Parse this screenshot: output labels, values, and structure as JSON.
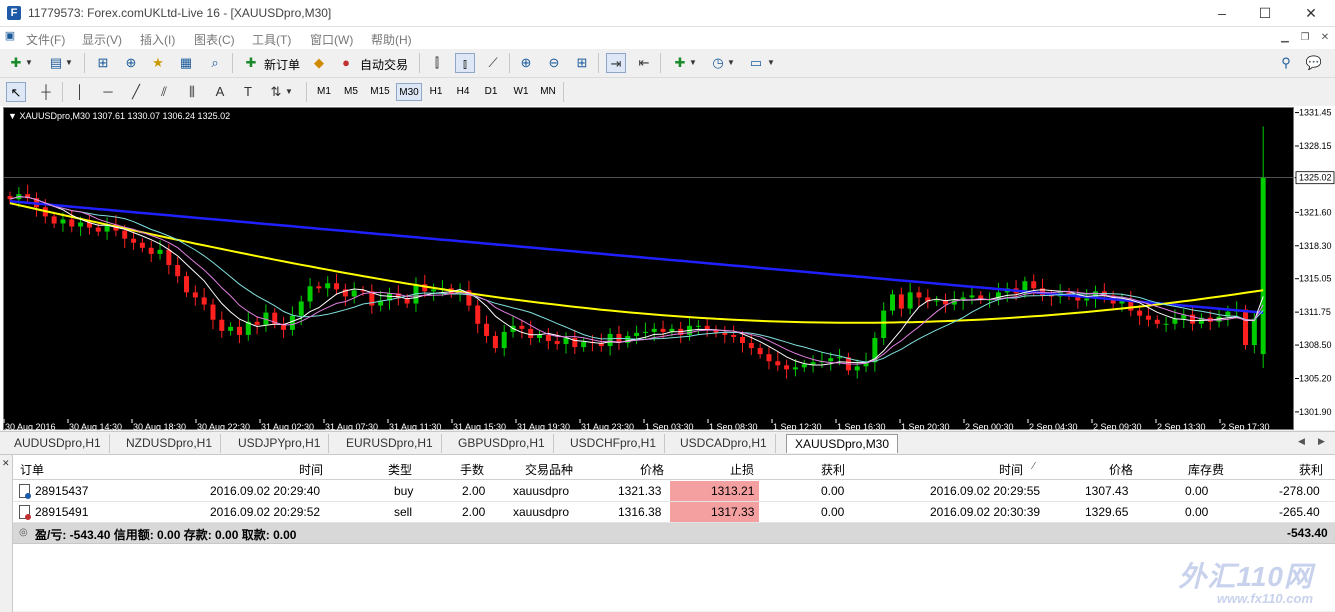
{
  "window": {
    "title": "11779573: Forex.comUKLtd-Live 16 - [XAUUSDpro,M30]",
    "app_icon": "F",
    "controls": [
      "–",
      "☐",
      "✕"
    ]
  },
  "menu": {
    "items": [
      "文件(F)",
      "显示(V)",
      "插入(I)",
      "图表(C)",
      "工具(T)",
      "窗口(W)",
      "帮助(H)"
    ]
  },
  "toolbar": {
    "new_order_label": "新订单",
    "auto_trade_label": "自动交易"
  },
  "timeframes": [
    "M1",
    "M5",
    "M15",
    "M30",
    "H1",
    "H4",
    "D1",
    "W1",
    "MN"
  ],
  "active_timeframe": "M30",
  "chart": {
    "header": "XAUUSDpro,M30  1307.61 1330.07 1306.24 1325.02",
    "current_price_label": "1325.02"
  },
  "chart_data": {
    "type": "candlestick",
    "symbol": "XAUUSDpro",
    "timeframe": "M30",
    "ohlc_last": {
      "open": 1307.61,
      "high": 1330.07,
      "low": 1306.24,
      "close": 1325.02
    },
    "price_ticks": [
      1331.45,
      1328.15,
      1325.02,
      1321.6,
      1318.3,
      1315.05,
      1311.75,
      1308.5,
      1305.2,
      1301.9
    ],
    "ylim": [
      1301.3,
      1331.9
    ],
    "time_ticks": [
      "30 Aug 2016",
      "30 Aug 14:30",
      "30 Aug 18:30",
      "30 Aug 22:30",
      "31 Aug 02:30",
      "31 Aug 07:30",
      "31 Aug 11:30",
      "31 Aug 15:30",
      "31 Aug 19:30",
      "31 Aug 23:30",
      "1 Sep 03:30",
      "1 Sep 08:30",
      "1 Sep 12:30",
      "1 Sep 16:30",
      "1 Sep 20:30",
      "2 Sep 00:30",
      "2 Sep 04:30",
      "2 Sep 09:30",
      "2 Sep 13:30",
      "2 Sep 17:30"
    ],
    "colors": {
      "background": "#000000",
      "bull": "#00cc00",
      "bear": "#ff2020",
      "ma_slow": "#2020ff",
      "ma_mid": "#ffff00",
      "ma_fast1": "#ffffff",
      "ma_fast2": "#80e0e0",
      "ma_fast3": "#e080e0"
    },
    "close_path": [
      1322.9,
      1323.4,
      1323.0,
      1322.1,
      1321.2,
      1320.5,
      1320.9,
      1320.2,
      1320.6,
      1320.1,
      1319.7,
      1320.4,
      1319.8,
      1319.0,
      1318.6,
      1318.1,
      1317.5,
      1317.9,
      1316.4,
      1315.3,
      1313.7,
      1313.2,
      1312.5,
      1311.0,
      1309.9,
      1310.3,
      1309.5,
      1310.8,
      1310.5,
      1311.7,
      1310.6,
      1310.0,
      1311.4,
      1312.8,
      1314.3,
      1314.1,
      1314.6,
      1314.0,
      1313.3,
      1313.9,
      1313.8,
      1312.4,
      1312.9,
      1313.6,
      1313.1,
      1312.6,
      1314.5,
      1313.8,
      1314.0,
      1314.1,
      1313.6,
      1313.9,
      1312.4,
      1310.6,
      1309.4,
      1308.2,
      1309.8,
      1310.4,
      1310.1,
      1309.2,
      1309.5,
      1308.9,
      1308.6,
      1309.2,
      1308.3,
      1308.8,
      1308.7,
      1308.4,
      1309.6,
      1308.7,
      1309.4,
      1309.7,
      1309.8,
      1310.1,
      1309.8,
      1310.1,
      1309.5,
      1310.4,
      1310.4,
      1310.0,
      1309.7,
      1309.5,
      1309.3,
      1308.7,
      1308.2,
      1307.6,
      1306.9,
      1306.5,
      1306.1,
      1306.3,
      1306.6,
      1306.8,
      1306.9,
      1307.2,
      1307.3,
      1306.0,
      1306.4,
      1306.8,
      1309.2,
      1311.9,
      1313.5,
      1312.1,
      1313.7,
      1313.2,
      1312.8,
      1312.9,
      1312.5,
      1312.9,
      1313.2,
      1313.4,
      1313.0,
      1313.0,
      1313.7,
      1314.1,
      1313.6,
      1314.8,
      1314.1,
      1313.4,
      1313.3,
      1313.7,
      1313.4,
      1312.9,
      1313.1,
      1313.8,
      1313.4,
      1312.6,
      1312.9,
      1311.9,
      1311.4,
      1311.0,
      1310.6,
      1310.6,
      1311.1,
      1311.5,
      1310.6,
      1311.2,
      1310.8,
      1311.3,
      1311.8,
      1312.0,
      1308.5,
      1311.1,
      1325.0
    ],
    "ma_slow": [
      1322.7,
      1311.7
    ],
    "ma_mid": [
      1322.5,
      1310.7
    ]
  },
  "tabs": [
    "AUDUSDpro,H1",
    "NZDUSDpro,H1",
    "USDJPYpro,H1",
    "EURUSDpro,H1",
    "GBPUSDpro,H1",
    "USDCHFpro,H1",
    "USDCADpro,H1",
    "XAUUSDpro,M30"
  ],
  "active_tab": "XAUUSDpro,M30",
  "trade": {
    "headers": [
      "订单",
      "时间",
      "类型",
      "手数",
      "交易品种",
      "价格",
      "止损",
      "获利",
      "时间",
      "价格",
      "库存费",
      "获利"
    ],
    "rows": [
      {
        "order": "28915437",
        "open_time": "2016.09.02 20:29:40",
        "type": "buy",
        "lots": "2.00",
        "symbol": "xauusdpro",
        "open_price": "1321.33",
        "sl": "1313.21",
        "tp": "0.00",
        "close_time": "2016.09.02 20:29:55",
        "close_price": "1307.43",
        "swap": "0.00",
        "profit": "-278.00"
      },
      {
        "order": "28915491",
        "open_time": "2016.09.02 20:29:52",
        "type": "sell",
        "lots": "2.00",
        "symbol": "xauusdpro",
        "open_price": "1316.38",
        "sl": "1317.33",
        "tp": "0.00",
        "close_time": "2016.09.02 20:30:39",
        "close_price": "1329.65",
        "swap": "0.00",
        "profit": "-265.40"
      }
    ],
    "summary": "盈/亏: -543.40  信用额: 0.00  存款: 0.00  取款: 0.00",
    "summary_total": "-543.40"
  },
  "watermark": {
    "logo": "外汇110网",
    "url": "www.fx110.com"
  }
}
